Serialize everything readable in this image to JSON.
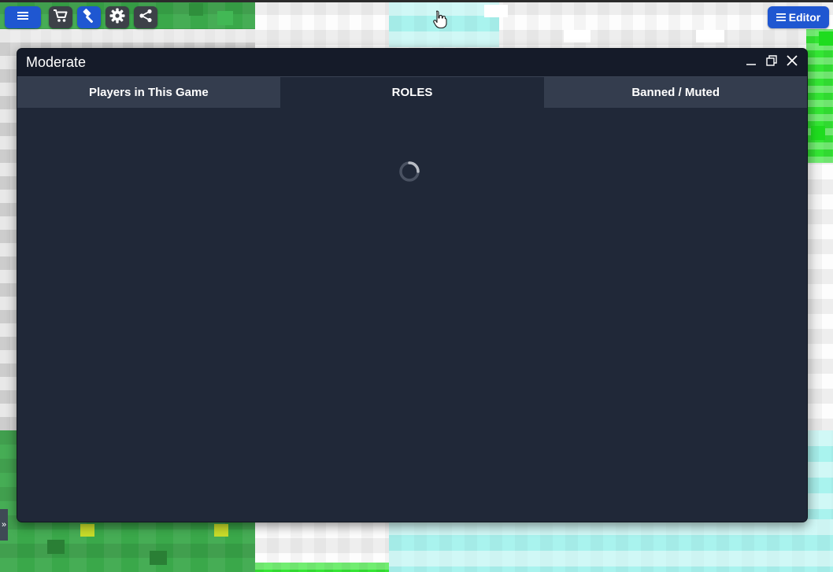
{
  "toolbar": {
    "buttons": [
      {
        "name": "menu-icon",
        "accent": "#1f57d1"
      },
      {
        "name": "cart-icon",
        "accent": "#3d4148"
      },
      {
        "name": "hammer-icon",
        "accent": "#1f57d1"
      },
      {
        "name": "gear-icon",
        "accent": "#3d4148"
      },
      {
        "name": "share-icon",
        "accent": "#3d4148"
      }
    ],
    "editor_label": "Editor",
    "editor_icon": "menu-icon"
  },
  "side_handle": {
    "label": "»"
  },
  "window": {
    "title": "Moderate",
    "controls": [
      "minimize-icon",
      "maximize-icon",
      "close-icon"
    ],
    "tabs": [
      {
        "label": "Players in This Game",
        "active": false
      },
      {
        "label": "ROLES",
        "active": true
      },
      {
        "label": "Banned / Muted",
        "active": false
      }
    ],
    "content": {
      "loading": true,
      "spinner_icon": "loading-spinner-icon"
    }
  },
  "colors": {
    "primary_blue": "#1f57d1",
    "window_bg": "#202838",
    "titlebar_bg": "#151b29",
    "inactive_tab_bg": "#343d4e",
    "toolbar_button_bg": "#3d4148"
  }
}
